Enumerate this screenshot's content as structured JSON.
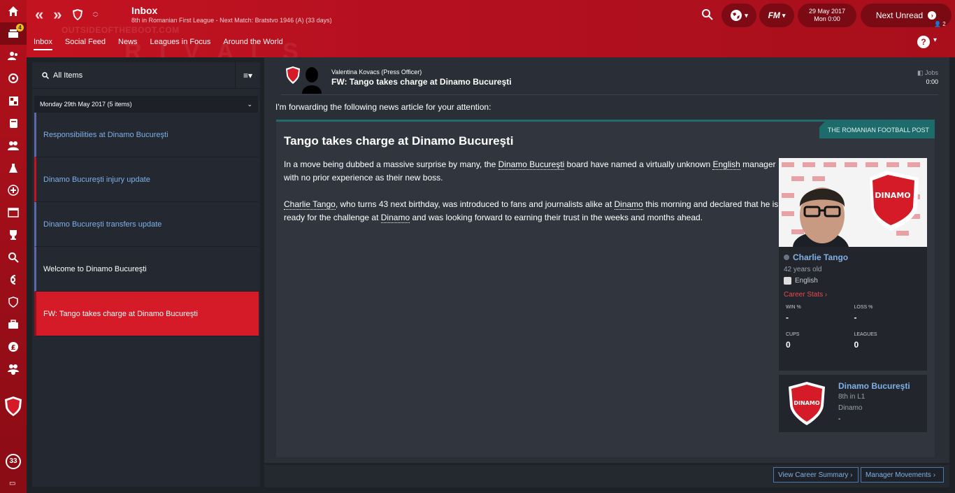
{
  "header": {
    "title": "Inbox",
    "subtitle": "8th in Romanian First League - Next Match: Bratstvo 1946 (A) (33 days)",
    "watermark": "OUTSIDEOFTHEBOOT.COM",
    "date_line1": "29 May 2017",
    "date_line2": "Mon 0:00",
    "next_unread": "Next Unread",
    "manager_count": "2",
    "fm_label": "FM"
  },
  "tabs": [
    "Inbox",
    "Social Feed",
    "News",
    "Leagues in Focus",
    "Around the World"
  ],
  "rail": {
    "inbox_badge": "4",
    "bottom_count": "33"
  },
  "list": {
    "filter_label": "All Items",
    "group_label": "Monday 29th May 2017 (5 items)",
    "items": [
      {
        "label": "Responsibilities at Dinamo Bucureşti"
      },
      {
        "label": "Dinamo Bucureşti injury update"
      },
      {
        "label": "Dinamo Bucureşti transfers update"
      },
      {
        "label": "Welcome to Dinamo Bucureşti"
      },
      {
        "label": "FW: Tango takes charge at Dinamo Bucureşti"
      }
    ]
  },
  "message": {
    "from": "Valentina Kovacs  (Press Officer)",
    "subject": "FW: Tango takes charge at Dinamo Bucureşti",
    "jobs_label": "Jobs",
    "time": "0:00",
    "intro": "I'm forwarding the following news article for your attention:"
  },
  "article": {
    "source": "THE ROMANIAN FOOTBALL POST",
    "title": "Tango takes charge at Dinamo Bucureşti",
    "p1_a": "In a move being dubbed a massive surprise by many, the ",
    "p1_link1": "Dinamo Bucureşti",
    "p1_b": " board have named a virtually unknown ",
    "p1_link2": "English",
    "p1_c": " manager with no prior experience as their new boss.",
    "p2_link1": "Charlie Tango",
    "p2_a": ", who turns 43 next birthday, was introduced to fans and journalists alike at ",
    "p2_link2": "Dinamo",
    "p2_b": " this morning and declared that he is ready for the challenge at ",
    "p2_link3": "Dinamo",
    "p2_c": " and was looking forward to earning their trust in the weeks and months ahead."
  },
  "person": {
    "name": "Charlie Tango",
    "age": "42 years old",
    "nationality": "English",
    "career_stats": "Career Stats ›",
    "win_label": "WIN %",
    "win_value": "-",
    "loss_label": "LOSS %",
    "loss_value": "-",
    "cups_label": "CUPS",
    "cups_value": "0",
    "leagues_label": "LEAGUES",
    "leagues_value": "0"
  },
  "club": {
    "name": "Dinamo Bucureşti",
    "position": "8th in L1",
    "stadium": "Dinamo",
    "value": "-"
  },
  "footer": {
    "view_career": "View Career Summary ›",
    "manager_movements": "Manager Movements ›"
  },
  "colors": {
    "accent_red": "#c41320",
    "link_blue": "#7fb0e8",
    "teal": "#1d6b6b"
  }
}
